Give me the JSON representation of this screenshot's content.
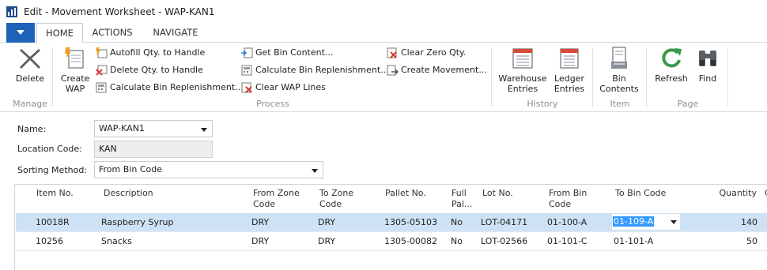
{
  "window": {
    "title": "Edit - Movement Worksheet - WAP-KAN1"
  },
  "tabs": [
    {
      "label": "HOME",
      "active": true
    },
    {
      "label": "ACTIONS",
      "active": false
    },
    {
      "label": "NAVIGATE",
      "active": false
    }
  ],
  "ribbon": {
    "manage": {
      "label": "Manage",
      "delete": "Delete"
    },
    "process": {
      "label": "Process",
      "create_wap": [
        "Create",
        "WAP"
      ],
      "autofill": "Autofill Qty. to Handle",
      "delete_qty": "Delete Qty. to Handle",
      "calc_bin_1": "Calculate Bin Replenishment...",
      "get_bin": "Get Bin Content...",
      "calc_bin_2": "Calculate Bin Replenishment...",
      "clear_wap": "Clear WAP Lines",
      "clear_zero": "Clear Zero Qty.",
      "create_movement": "Create Movement..."
    },
    "history": {
      "label": "History",
      "warehouse": [
        "Warehouse",
        "Entries"
      ],
      "ledger": [
        "Ledger",
        "Entries"
      ]
    },
    "item": {
      "label": "Item",
      "bin_contents": [
        "Bin",
        "Contents"
      ]
    },
    "page": {
      "label": "Page",
      "refresh": "Refresh",
      "find": "Find"
    }
  },
  "header_fields": {
    "name_label": "Name:",
    "name_value": "WAP-KAN1",
    "location_label": "Location Code:",
    "location_value": "KAN",
    "sorting_label": "Sorting Method:",
    "sorting_value": "From Bin Code"
  },
  "lines": {
    "columns": [
      [
        "Item No."
      ],
      [
        "Description"
      ],
      [
        "From Zone",
        "Code"
      ],
      [
        "To Zone",
        "Code"
      ],
      [
        "Pallet No."
      ],
      [
        "Full",
        "Pal..."
      ],
      [
        "Lot No."
      ],
      [
        "From Bin",
        "Code"
      ],
      [
        "To Bin Code"
      ],
      [
        "Quantity"
      ],
      [
        "C"
      ]
    ],
    "rows": [
      {
        "item_no": "10018R",
        "description": "Raspberry Syrup",
        "from_zone": "DRY",
        "to_zone": "DRY",
        "pallet_no": "1305-05103",
        "full_pallet": "No",
        "lot_no": "LOT-04171",
        "from_bin": "01-100-A",
        "to_bin": "01-109-A",
        "quantity": "140",
        "selected": true
      },
      {
        "item_no": "10256",
        "description": "Snacks",
        "from_zone": "DRY",
        "to_zone": "DRY",
        "pallet_no": "1305-00082",
        "full_pallet": "No",
        "lot_no": "LOT-02566",
        "from_bin": "01-101-C",
        "to_bin": "01-101-A",
        "quantity": "50",
        "selected": false
      }
    ]
  },
  "colors": {
    "accent": "#1c63b7",
    "selected_row": "#cde2f5",
    "selection": "#3399ff",
    "refresh_green": "#3a9a48"
  }
}
